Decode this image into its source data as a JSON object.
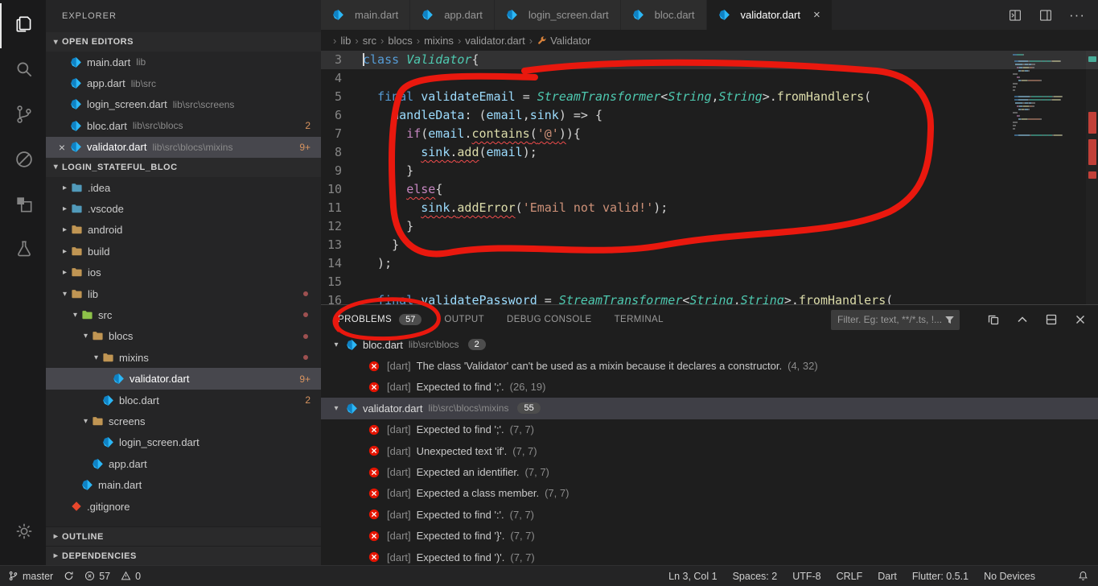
{
  "activity_bar": {
    "items": [
      {
        "icon": "explorer-icon",
        "active": true
      },
      {
        "icon": "search-icon"
      },
      {
        "icon": "source-control-icon"
      },
      {
        "icon": "debug-icon"
      },
      {
        "icon": "extensions-icon"
      },
      {
        "icon": "test-beaker-icon"
      }
    ],
    "bottom_items": [
      {
        "icon": "settings-gear-icon"
      }
    ]
  },
  "sidebar": {
    "title": "EXPLORER",
    "open_editors": {
      "header": "OPEN EDITORS",
      "items": [
        {
          "name": "main.dart",
          "path": "lib"
        },
        {
          "name": "app.dart",
          "path": "lib\\src"
        },
        {
          "name": "login_screen.dart",
          "path": "lib\\src\\screens"
        },
        {
          "name": "bloc.dart",
          "path": "lib\\src\\blocs",
          "badge": "2"
        },
        {
          "name": "validator.dart",
          "path": "lib\\src\\blocs\\mixins",
          "badge": "9+",
          "selected": true
        }
      ]
    },
    "project": {
      "header": "LOGIN_STATEFUL_BLOC",
      "items": [
        {
          "label": ".idea",
          "kind": "folder",
          "state": "collapsed",
          "level": 0,
          "color": "#519aba"
        },
        {
          "label": ".vscode",
          "kind": "folder",
          "state": "collapsed",
          "level": 0,
          "color": "#519aba"
        },
        {
          "label": "android",
          "kind": "folder",
          "state": "collapsed",
          "level": 0,
          "color": "#c09553"
        },
        {
          "label": "build",
          "kind": "folder",
          "state": "collapsed",
          "level": 0,
          "color": "#c09553"
        },
        {
          "label": "ios",
          "kind": "folder",
          "state": "collapsed",
          "level": 0,
          "color": "#c09553"
        },
        {
          "label": "lib",
          "kind": "folder",
          "state": "expanded",
          "level": 0,
          "color": "#c09553",
          "dot": true
        },
        {
          "label": "src",
          "kind": "folder",
          "state": "expanded",
          "level": 1,
          "color": "#8dc149",
          "dot": true
        },
        {
          "label": "blocs",
          "kind": "folder",
          "state": "expanded",
          "level": 2,
          "color": "#c09553",
          "dot": true
        },
        {
          "label": "mixins",
          "kind": "folder",
          "state": "expanded",
          "level": 3,
          "color": "#c09553",
          "dot": true
        },
        {
          "label": "validator.dart",
          "kind": "dart",
          "level": 4,
          "badge": "9+",
          "selected": true
        },
        {
          "label": "bloc.dart",
          "kind": "dart",
          "level": 3,
          "badge": "2"
        },
        {
          "label": "screens",
          "kind": "folder",
          "state": "expanded",
          "level": 2,
          "color": "#c09553"
        },
        {
          "label": "login_screen.dart",
          "kind": "dart",
          "level": 3
        },
        {
          "label": "app.dart",
          "kind": "dart",
          "level": 2
        },
        {
          "label": "main.dart",
          "kind": "dart",
          "level": 1
        },
        {
          "label": ".gitignore",
          "kind": "git",
          "level": 0
        }
      ]
    },
    "bottom_sections": [
      "OUTLINE",
      "DEPENDENCIES"
    ]
  },
  "editor_tabs": [
    {
      "label": "main.dart"
    },
    {
      "label": "app.dart"
    },
    {
      "label": "login_screen.dart"
    },
    {
      "label": "bloc.dart"
    },
    {
      "label": "validator.dart",
      "active": true
    }
  ],
  "breadcrumbs": {
    "items": [
      "lib",
      "src",
      "blocs",
      "mixins",
      "validator.dart"
    ],
    "symbol": "Validator"
  },
  "editor": {
    "lines": [
      {
        "num": 3,
        "current": true,
        "tokens": [
          [
            "class ",
            "kw"
          ],
          [
            "Validator",
            "cls"
          ],
          [
            "{",
            "pun"
          ]
        ]
      },
      {
        "num": 4,
        "tokens": []
      },
      {
        "num": 5,
        "tokens": [
          [
            "  ",
            "pun"
          ],
          [
            "final ",
            "kw"
          ],
          [
            "validateEmail ",
            "var"
          ],
          [
            "= ",
            "pun"
          ],
          [
            "StreamTransformer",
            "cls"
          ],
          [
            "<",
            "pun"
          ],
          [
            "String",
            "cls"
          ],
          [
            ",",
            "pun"
          ],
          [
            "String",
            "cls"
          ],
          [
            ">",
            "pun"
          ],
          [
            ".",
            "pun"
          ],
          [
            "fromHandlers",
            "fn"
          ],
          [
            "(",
            "pun"
          ]
        ]
      },
      {
        "num": 6,
        "tokens": [
          [
            "    ",
            "pun"
          ],
          [
            "handleData",
            "var"
          ],
          [
            ": (",
            "pun"
          ],
          [
            "email",
            "var"
          ],
          [
            ",",
            "pun"
          ],
          [
            "sink",
            "var"
          ],
          [
            ") => {",
            "pun"
          ]
        ]
      },
      {
        "num": 7,
        "tokens": [
          [
            "      ",
            "pun"
          ],
          [
            "if",
            "ctrl"
          ],
          [
            "(",
            "pun"
          ],
          [
            "email",
            "var"
          ],
          [
            ".",
            "pun"
          ],
          [
            "contains",
            "fn",
            true
          ],
          [
            "(",
            "pun",
            true
          ],
          [
            "'@'",
            "str",
            true
          ],
          [
            ")",
            "pun",
            true
          ],
          [
            "){",
            "pun"
          ]
        ]
      },
      {
        "num": 8,
        "tokens": [
          [
            "        ",
            "pun"
          ],
          [
            "sink",
            "var",
            true
          ],
          [
            ".",
            "pun",
            true
          ],
          [
            "add",
            "fn",
            true
          ],
          [
            "(",
            "pun"
          ],
          [
            "email",
            "var"
          ],
          [
            ");",
            "pun"
          ]
        ]
      },
      {
        "num": 9,
        "tokens": [
          [
            "      }",
            "pun"
          ]
        ]
      },
      {
        "num": 10,
        "tokens": [
          [
            "      ",
            "pun"
          ],
          [
            "else",
            "ctrl",
            true
          ],
          [
            "{",
            "pun"
          ]
        ]
      },
      {
        "num": 11,
        "tokens": [
          [
            "        ",
            "pun"
          ],
          [
            "sink",
            "var",
            true
          ],
          [
            ".",
            "pun",
            true
          ],
          [
            "addError",
            "fn",
            true
          ],
          [
            "(",
            "pun"
          ],
          [
            "'Email not valid!'",
            "str"
          ],
          [
            ");",
            "pun"
          ]
        ]
      },
      {
        "num": 12,
        "tokens": [
          [
            "      }",
            "pun"
          ]
        ]
      },
      {
        "num": 13,
        "tokens": [
          [
            "    }",
            "pun"
          ]
        ]
      },
      {
        "num": 14,
        "tokens": [
          [
            "  );",
            "pun"
          ]
        ]
      },
      {
        "num": 15,
        "tokens": []
      },
      {
        "num": 16,
        "tokens": [
          [
            "  ",
            "pun"
          ],
          [
            "final ",
            "kw",
            true
          ],
          [
            "validatePassword ",
            "var",
            true
          ],
          [
            "= ",
            "pun",
            true
          ],
          [
            "StreamTransformer",
            "cls",
            true
          ],
          [
            "<",
            "pun",
            true
          ],
          [
            "String",
            "cls",
            true
          ],
          [
            ",",
            "pun",
            true
          ],
          [
            "String",
            "cls",
            true
          ],
          [
            ">",
            "pun",
            true
          ],
          [
            ".",
            "pun",
            true
          ],
          [
            "fromHandlers",
            "fn",
            true
          ],
          [
            "(",
            "pun",
            true
          ]
        ]
      }
    ]
  },
  "panel": {
    "tabs": [
      {
        "label": "PROBLEMS",
        "badge": "57",
        "active": true
      },
      {
        "label": "OUTPUT"
      },
      {
        "label": "DEBUG CONSOLE"
      },
      {
        "label": "TERMINAL"
      }
    ],
    "filter_placeholder": "Filter. Eg: text, **/*.ts, !...",
    "groups": [
      {
        "file": "bloc.dart",
        "path": "lib\\src\\blocs",
        "count": "2",
        "items": [
          {
            "source": "[dart]",
            "message": "The class 'Validator' can't be used as a mixin because it declares a constructor.",
            "location": "(4, 32)"
          },
          {
            "source": "[dart]",
            "message": "Expected to find ';'.",
            "location": "(26, 19)"
          }
        ]
      },
      {
        "file": "validator.dart",
        "path": "lib\\src\\blocs\\mixins",
        "count": "55",
        "selected": true,
        "items": [
          {
            "source": "[dart]",
            "message": "Expected to find ';'.",
            "location": "(7, 7)"
          },
          {
            "source": "[dart]",
            "message": "Unexpected text 'if'.",
            "location": "(7, 7)"
          },
          {
            "source": "[dart]",
            "message": "Expected an identifier.",
            "location": "(7, 7)"
          },
          {
            "source": "[dart]",
            "message": "Expected a class member.",
            "location": "(7, 7)"
          },
          {
            "source": "[dart]",
            "message": "Expected to find ':'.",
            "location": "(7, 7)"
          },
          {
            "source": "[dart]",
            "message": "Expected to find '}'.",
            "location": "(7, 7)"
          },
          {
            "source": "[dart]",
            "message": "Expected to find ')'.",
            "location": "(7, 7)"
          }
        ]
      }
    ]
  },
  "status_bar": {
    "left": [
      {
        "name": "git-branch",
        "icon": "branch",
        "label": "master"
      },
      {
        "name": "sync",
        "icon": "sync",
        "label": ""
      },
      {
        "name": "errors",
        "icon": "error",
        "label": "57"
      },
      {
        "name": "warnings",
        "icon": "warning",
        "label": "0"
      }
    ],
    "right": [
      {
        "name": "cursor-position",
        "label": "Ln 3, Col 1"
      },
      {
        "name": "indentation",
        "label": "Spaces: 2"
      },
      {
        "name": "encoding",
        "label": "UTF-8"
      },
      {
        "name": "eol",
        "label": "CRLF"
      },
      {
        "name": "language-mode",
        "label": "Dart"
      },
      {
        "name": "flutter-version",
        "label": "Flutter: 0.5.1"
      },
      {
        "name": "devices",
        "label": "No Devices"
      },
      {
        "name": "notifications",
        "icon": "bell",
        "label": ""
      }
    ]
  },
  "colors": {
    "annotation_red": "#e9180e",
    "error_red": "#e51400",
    "dart_blue": "#2cb7f6",
    "problem_badge_text": "#d7935f",
    "editor_background": "#1e1e1e",
    "sidebar_background": "#252526"
  }
}
